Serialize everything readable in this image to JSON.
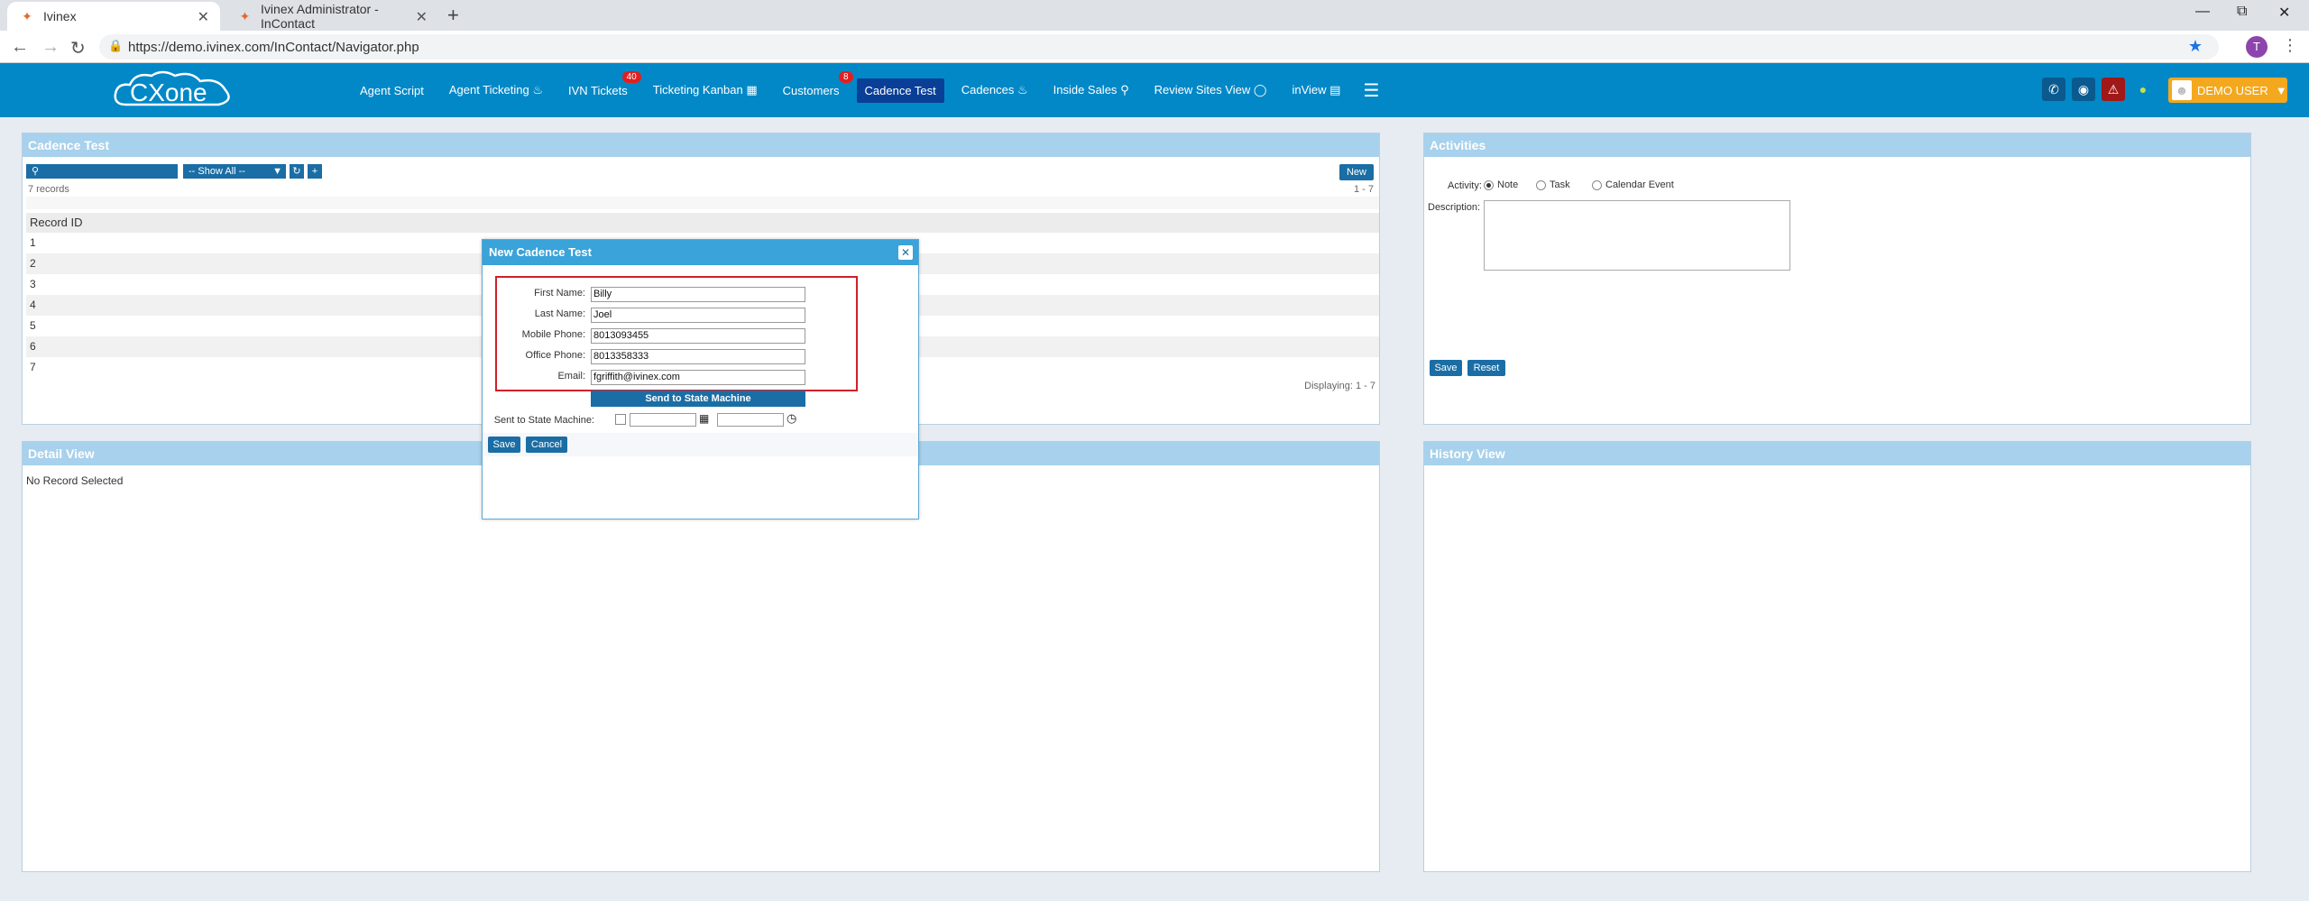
{
  "browser": {
    "tabs": [
      {
        "title": "Ivinex",
        "active": true
      },
      {
        "title": "Ivinex Administrator - InContact",
        "active": false
      }
    ],
    "url": "https://demo.ivinex.com/InContact/Navigator.php",
    "profile_initial": "T"
  },
  "app": {
    "logo_text": "CXone",
    "nav": [
      {
        "label": "Agent Script"
      },
      {
        "label": "Agent Ticketing",
        "icon": "fire-icon"
      },
      {
        "label": "IVN Tickets",
        "badge": "40"
      },
      {
        "label": "Ticketing Kanban",
        "icon": "board-icon"
      },
      {
        "label": "Customers",
        "badge": "8"
      },
      {
        "label": "Cadence Test",
        "active": true
      },
      {
        "label": "Cadences",
        "icon": "fire-icon"
      },
      {
        "label": "Inside Sales",
        "icon": "pin-icon"
      },
      {
        "label": "Review Sites View",
        "icon": "comment-icon"
      },
      {
        "label": "inView",
        "icon": "chart-icon"
      }
    ],
    "user_label": "DEMO USER",
    "colors": {
      "header": "#0288c7",
      "active_nav": "#0a3f97",
      "alert": "#a01818",
      "user": "#f3a81e"
    }
  },
  "cadence_panel": {
    "title": "Cadence Test",
    "filter_select": "-- Show All --",
    "new_label": "New",
    "records_count": "7 records",
    "page_range": "1 - 7",
    "column_header": "Record ID",
    "rows": [
      "1",
      "2",
      "3",
      "4",
      "5",
      "6",
      "7"
    ],
    "displaying": "Displaying: 1 - 7"
  },
  "activities_panel": {
    "title": "Activities",
    "activity_label": "Activity:",
    "options": [
      "Note",
      "Task",
      "Calendar Event"
    ],
    "selected": "Note",
    "description_label": "Description:",
    "save_label": "Save",
    "reset_label": "Reset"
  },
  "detail_panel": {
    "title": "Detail View",
    "empty_text": "No Record Selected"
  },
  "history_panel": {
    "title": "History View"
  },
  "modal": {
    "title": "New Cadence Test",
    "fields": [
      {
        "label": "First Name:",
        "value": "Billy"
      },
      {
        "label": "Last Name:",
        "value": "Joel"
      },
      {
        "label": "Mobile Phone:",
        "value": "8013093455"
      },
      {
        "label": "Office Phone:",
        "value": "8013358333"
      },
      {
        "label": "Email:",
        "value": "fgriffith@ivinex.com"
      }
    ],
    "send_button": "Send to State Machine",
    "sent_label": "Sent to State Machine:",
    "save_label": "Save",
    "cancel_label": "Cancel"
  }
}
